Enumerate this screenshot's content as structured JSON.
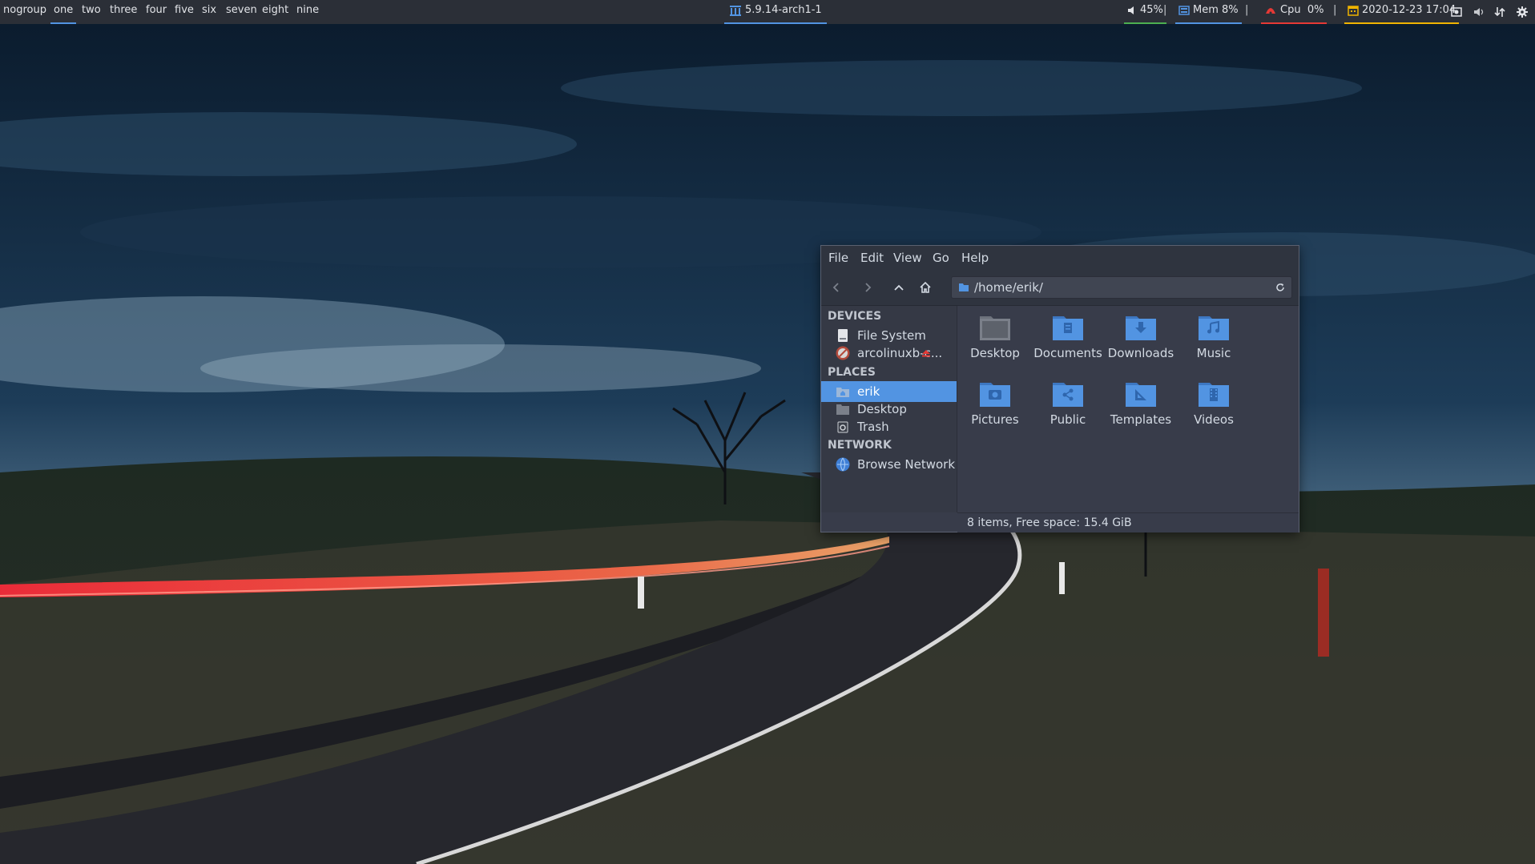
{
  "panel": {
    "workspaces": [
      "nogroup",
      "one",
      "two",
      "three",
      "four",
      "five",
      "six",
      "seven",
      "eight",
      "nine"
    ],
    "active_workspace": "one",
    "kernel": "5.9.14-arch1-1",
    "volume": "45%",
    "memory": "Mem 8%",
    "cpu_label": "Cpu",
    "cpu_value": "0%",
    "datetime": "2020-12-23 17:04",
    "separator": "|",
    "colors": {
      "volume": "#4caf50",
      "memory": "#5294e2",
      "cpu": "#e53935",
      "datetime": "#f0b400",
      "accent": "#5294e2"
    },
    "tray_icons": [
      "screenshot-icon",
      "volume-icon",
      "network-icon",
      "settings-gear-icon"
    ]
  },
  "file_manager": {
    "menu": [
      "File",
      "Edit",
      "View",
      "Go",
      "Help"
    ],
    "toolbar_icons": [
      "back-icon",
      "forward-icon",
      "up-icon",
      "home-icon"
    ],
    "location_path": "/home/erik/",
    "sidebar": {
      "devices_header": "DEVICES",
      "devices": [
        {
          "label": "File System",
          "icon": "drive-icon"
        },
        {
          "label": "arcolinuxb-c...",
          "icon": "disc-icon",
          "eject_icon": "eject-icon"
        }
      ],
      "places_header": "PLACES",
      "places": [
        {
          "label": "erik",
          "icon": "home-folder-icon",
          "selected": true
        },
        {
          "label": "Desktop",
          "icon": "desktop-folder-icon"
        },
        {
          "label": "Trash",
          "icon": "trash-icon"
        }
      ],
      "network_header": "NETWORK",
      "network": [
        {
          "label": "Browse Network",
          "icon": "network-globe-icon"
        }
      ]
    },
    "files": [
      {
        "name": "Desktop",
        "icon": "desktop-folder-icon"
      },
      {
        "name": "Documents",
        "icon": "documents-folder-icon"
      },
      {
        "name": "Downloads",
        "icon": "downloads-folder-icon"
      },
      {
        "name": "Music",
        "icon": "music-folder-icon"
      },
      {
        "name": "Pictures",
        "icon": "pictures-folder-icon"
      },
      {
        "name": "Public",
        "icon": "public-folder-icon"
      },
      {
        "name": "Templates",
        "icon": "templates-folder-icon"
      },
      {
        "name": "Videos",
        "icon": "videos-folder-icon"
      }
    ],
    "status": "8 items, Free space: 15.4 GiB"
  }
}
